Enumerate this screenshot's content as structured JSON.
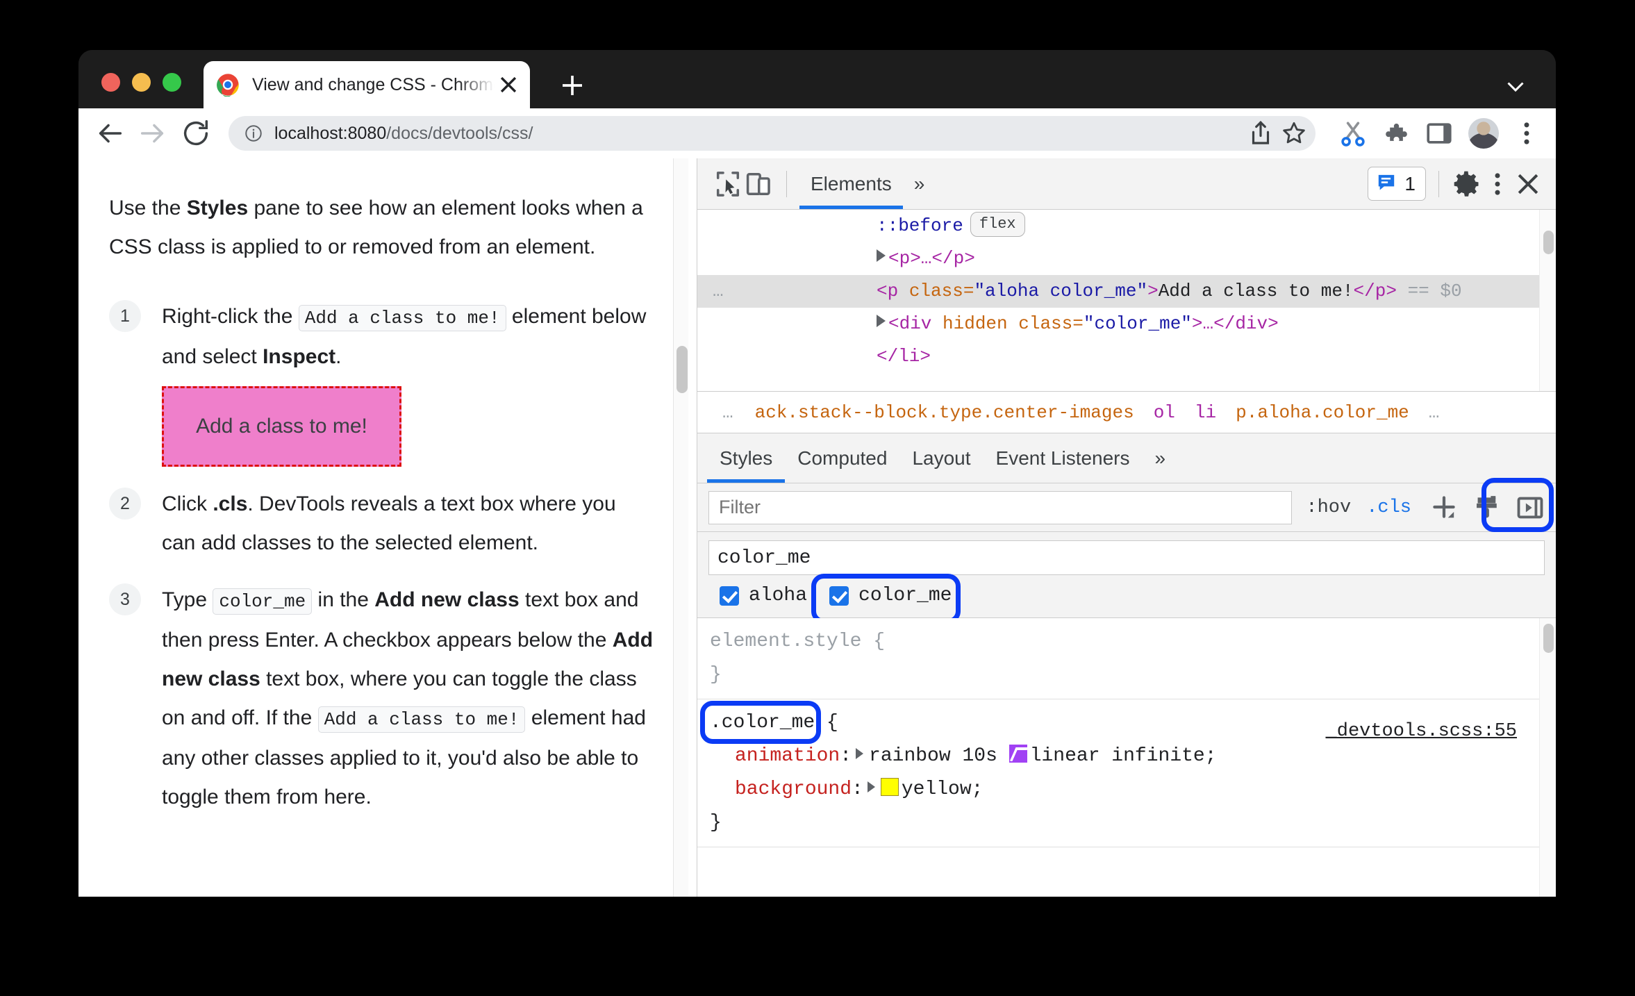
{
  "window": {
    "tab": {
      "title": "View and change CSS - Chrome",
      "favicon": "chrome-logo-icon",
      "close": "close-icon"
    },
    "new_tab_label": "+",
    "chevron": "chevron-down-icon"
  },
  "toolbar": {
    "back": "back-arrow-icon",
    "forward": "forward-arrow-icon",
    "reload": "reload-icon",
    "info": "info-circle-icon",
    "url_host": "localhost:8080",
    "url_path": "/docs/devtools/css/",
    "url_full": "localhost:8080/docs/devtools/css/",
    "icons": [
      "share-icon",
      "star-icon",
      "scissors-icon",
      "puzzle-extensions-icon",
      "side-panel-icon",
      "avatar",
      "kebab-menu-icon"
    ]
  },
  "page": {
    "intro_pre": "Use the ",
    "intro_bold": "Styles",
    "intro_post": " pane to see how an element looks when a CSS class is applied to or removed from an element.",
    "steps": [
      {
        "num": "1",
        "parts": [
          {
            "t": "text",
            "v": "Right-click the "
          },
          {
            "t": "code",
            "v": "Add a class to me!"
          },
          {
            "t": "text",
            "v": " element below and select "
          },
          {
            "t": "bold",
            "v": "Inspect"
          },
          {
            "t": "text",
            "v": "."
          }
        ],
        "demo_box": "Add a class to me!"
      },
      {
        "num": "2",
        "parts": [
          {
            "t": "text",
            "v": "Click "
          },
          {
            "t": "bold",
            "v": ".cls"
          },
          {
            "t": "text",
            "v": ". DevTools reveals a text box where you can add classes to the selected element."
          }
        ]
      },
      {
        "num": "3",
        "parts": [
          {
            "t": "text",
            "v": "Type "
          },
          {
            "t": "code",
            "v": "color_me"
          },
          {
            "t": "text",
            "v": " in the "
          },
          {
            "t": "bold",
            "v": "Add new class"
          },
          {
            "t": "text",
            "v": " text box and then press Enter. A checkbox appears below the "
          },
          {
            "t": "bold",
            "v": "Add new class"
          },
          {
            "t": "text",
            "v": " text box, where you can toggle the class on and off. If the "
          },
          {
            "t": "code",
            "v": "Add a class to me!"
          },
          {
            "t": "text",
            "v": " element had any other classes applied to it, you'd also be able to toggle them from here."
          }
        ]
      }
    ]
  },
  "devtools": {
    "toolbar": {
      "inspect_icon": "inspect-element-icon",
      "device_icon": "device-toolbar-icon",
      "tabs": [
        {
          "label": "Elements",
          "active": true
        }
      ],
      "more_tabs": "»",
      "message_count": "1",
      "message_icon": "message-badge-icon",
      "settings_icon": "gear-icon",
      "kebab_icon": "kebab-menu-icon",
      "close_icon": "close-icon"
    },
    "dom": {
      "rows": [
        {
          "type": "pseudo",
          "indent": true,
          "text": "::before",
          "badge": "flex"
        },
        {
          "type": "collapsed",
          "indent": true,
          "tag": "p",
          "text": "<p>…</p>"
        },
        {
          "type": "selected",
          "ellipsis": "…",
          "html_open": "<p ",
          "attr": "class",
          "attr_value": "\"aloha color_me\"",
          "gt": ">",
          "text_content": "Add a class to me!",
          "html_close": "</p>",
          "suffix": "== $0"
        },
        {
          "type": "collapsed",
          "indent": true,
          "tag": "div",
          "html": "<div hidden class=\"color_me\">…</div>"
        },
        {
          "type": "close",
          "html": "</li>"
        }
      ]
    },
    "breadcrumbs": [
      {
        "label": "…",
        "kind": "ellipsis"
      },
      {
        "label": "ack.stack--block.type.center-images",
        "kind": "selector"
      },
      {
        "label": "ol",
        "kind": "tag"
      },
      {
        "label": "li",
        "kind": "tag"
      },
      {
        "label": "p.aloha.color_me",
        "kind": "selector"
      },
      {
        "label": "…",
        "kind": "ellipsis"
      }
    ],
    "styles_tabs": [
      {
        "label": "Styles",
        "active": true
      },
      {
        "label": "Computed",
        "active": false
      },
      {
        "label": "Layout",
        "active": false
      },
      {
        "label": "Event Listeners",
        "active": false
      },
      {
        "label": "»",
        "active": false
      }
    ],
    "filter": {
      "placeholder": "Filter",
      "value": "",
      "hov_label": ":hov",
      "cls_label": ".cls",
      "cls_annotated": true,
      "new_rule_icon": "plus-icon",
      "computed_sidebar_icon": "paintbrush-icon",
      "toggle_pane_icon": "collapse-pane-icon"
    },
    "class_editor": {
      "input_value": "color_me",
      "classes": [
        {
          "label": "aloha",
          "checked": true,
          "annotated": false
        },
        {
          "label": "color_me",
          "checked": true,
          "annotated": true
        }
      ]
    },
    "rules": [
      {
        "selector": "element.style",
        "selector_style": "gray",
        "open": "{",
        "close": "}",
        "source": "",
        "declarations": []
      },
      {
        "selector": ".color_me",
        "selector_style": "dark",
        "selector_annotated": true,
        "open": "{",
        "close": "}",
        "source": "_devtools.scss:55",
        "declarations": [
          {
            "prop": "animation",
            "value_pre": "rainbow 10s ",
            "swatch": "easing",
            "value_post": "linear infinite",
            "end": ";"
          },
          {
            "prop": "background",
            "value_pre": "",
            "swatch": "color",
            "swatch_color": "#ffff00",
            "value_post": "yellow",
            "end": ";"
          }
        ]
      }
    ]
  },
  "colors": {
    "accent": "#1a73e8",
    "annotation_ring": "#0b3bf5",
    "demo_box_bg": "#ef7fcb",
    "demo_box_border": "#dd1111",
    "swatch_yellow": "#ffff00",
    "easing_purple": "#a142f4"
  }
}
